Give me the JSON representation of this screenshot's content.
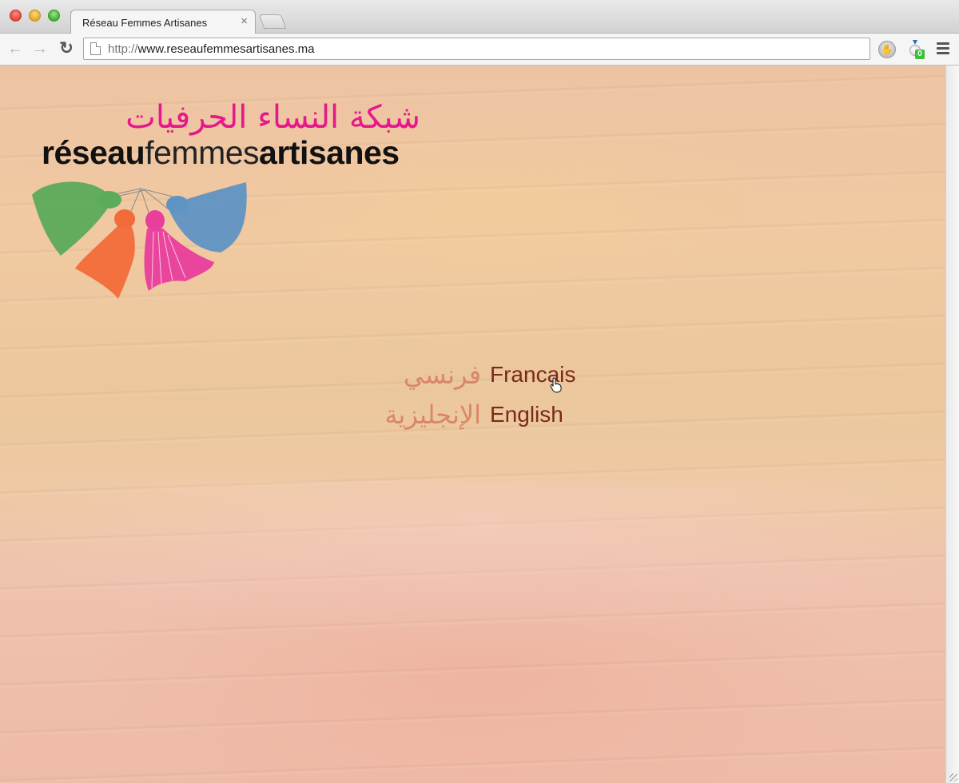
{
  "browser": {
    "tab_title": "Réseau Femmes Artisanes",
    "tab_close": "×",
    "url_scheme": "http://",
    "url_host": "www.reseaufemmesartisanes.ma",
    "badge_count": "0"
  },
  "logo": {
    "arabic": "شبكة النساء الحرفيات",
    "word1": "réseau",
    "word2": "femmes",
    "word3": "artisanes",
    "tassel_colors": [
      "#5cab5a",
      "#f26b3a",
      "#e83e9c",
      "#5f93c4"
    ]
  },
  "languages": [
    {
      "arabic": "فرنسي",
      "label": "Francais"
    },
    {
      "arabic": "الإنجليزية",
      "label": "English"
    }
  ],
  "colors": {
    "logo_arabic": "#e6198a",
    "lang_arabic": "#d9876a",
    "lang_latin": "#7a2a1c"
  }
}
